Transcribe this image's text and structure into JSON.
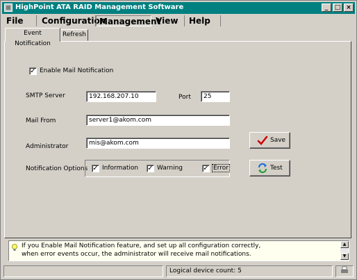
{
  "window": {
    "title": "HighPoint ATA RAID Management Software",
    "controls": {
      "minimize": "_",
      "maximize": "□",
      "close": "×"
    }
  },
  "menu": [
    {
      "label": "File"
    },
    {
      "label": "Configuration"
    },
    {
      "label": "Management"
    },
    {
      "label": "View"
    },
    {
      "label": "Help"
    }
  ],
  "tabs": [
    {
      "label": "Event Notification",
      "active": true
    },
    {
      "label": "Refresh",
      "active": false
    }
  ],
  "form": {
    "enable_mail": {
      "label": "Enable Mail Notification",
      "checked": true,
      "mark": "✓"
    },
    "smtp_server": {
      "label": "SMTP Server",
      "value": "192.168.207.10"
    },
    "port": {
      "label": "Port",
      "value": "25"
    },
    "mail_from": {
      "label": "Mail From",
      "value": "server1@akom.com"
    },
    "administrator": {
      "label": "Administrator",
      "value": "mis@akom.com"
    },
    "notification_options": {
      "label": "Notification Options",
      "information": {
        "label": "Information",
        "checked": true,
        "mark": "✓"
      },
      "warning": {
        "label": "Warning",
        "checked": true,
        "mark": "✓"
      },
      "error": {
        "label": "Error",
        "checked": true,
        "mark": "✓"
      }
    }
  },
  "buttons": {
    "save": {
      "label": "Save",
      "icon": "checkmark-icon"
    },
    "test": {
      "label": "Test",
      "icon": "refresh-icon"
    }
  },
  "message": {
    "icon": "lightbulb-icon",
    "line1": "If you Enable Mail Notification feature, and set up all configuration correctly,",
    "line2": "when error events occur, the administrator will receive mail notifications."
  },
  "status": {
    "logical_device_count": "Logical device count: 5"
  },
  "colors": {
    "titlebar": "#008080",
    "face": "#d4d0c8",
    "save_check": "#cc0000",
    "test_icon": "#1a6fd6"
  }
}
